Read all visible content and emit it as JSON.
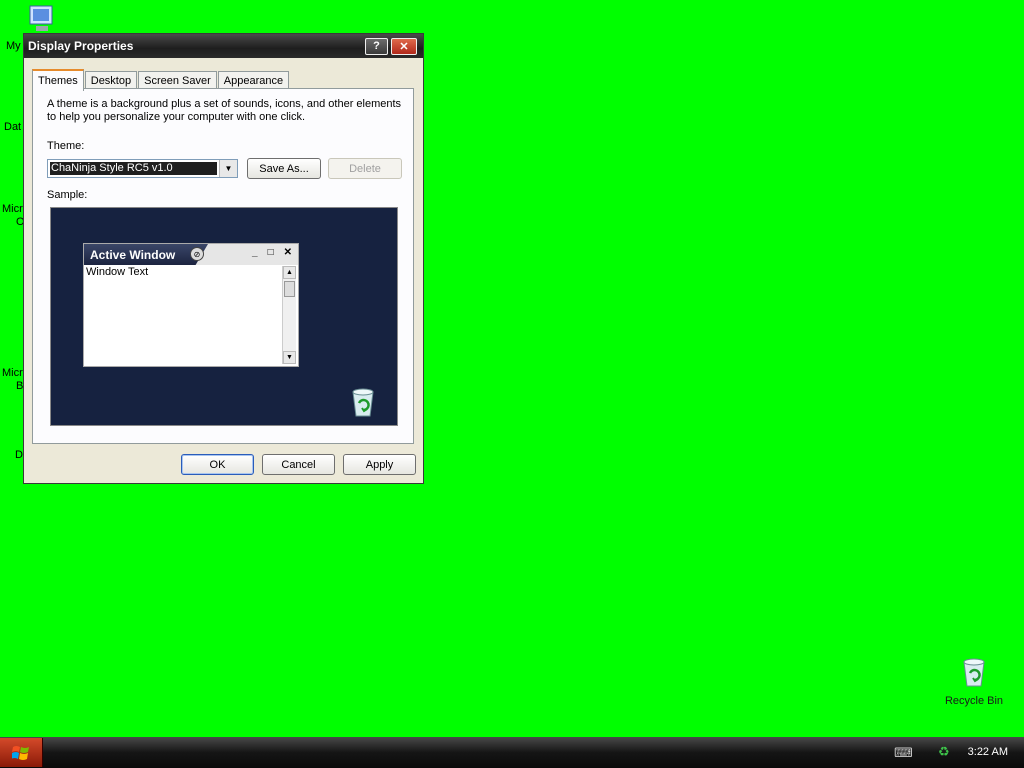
{
  "desktop": {
    "icon_labels": [
      "My",
      "Dat",
      "Micr",
      "O",
      "Micr",
      "B",
      "D"
    ],
    "recycle_bin_label": "Recycle Bin"
  },
  "window": {
    "title": "Display Properties",
    "help_glyph": "?",
    "close_glyph": "✕",
    "tabs": [
      "Themes",
      "Desktop",
      "Screen Saver",
      "Appearance"
    ],
    "active_tab": "Themes",
    "description": "A theme is a background plus a set of sounds, icons, and other elements to help you personalize your computer with one click.",
    "theme_label": "Theme:",
    "theme_value": "ChaNinja Style RC5 v1.0",
    "save_as_label": "Save As...",
    "delete_label": "Delete",
    "sample_label": "Sample:",
    "sample": {
      "active_window_title": "Active Window",
      "window_text": "Window Text"
    },
    "ok_label": "OK",
    "cancel_label": "Cancel",
    "apply_label": "Apply"
  },
  "taskbar": {
    "clock": "3:22 AM"
  },
  "colors": {
    "desktop_background": "#00ff00",
    "sample_background": "#162240"
  }
}
